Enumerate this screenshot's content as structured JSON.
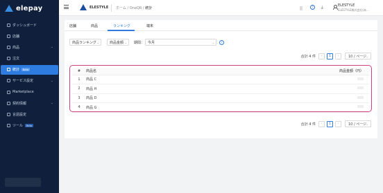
{
  "app": {
    "logo_text": "elepay"
  },
  "sidebar": {
    "items": [
      {
        "label": "ダッシュボード",
        "icon": "clock-icon",
        "chevron": false,
        "badge": "",
        "active": false
      },
      {
        "label": "店舗",
        "icon": "store-icon",
        "chevron": false,
        "badge": "",
        "active": false
      },
      {
        "label": "商品",
        "icon": "tag-icon",
        "chevron": true,
        "badge": "",
        "active": false
      },
      {
        "label": "注文",
        "icon": "cart-icon",
        "chevron": false,
        "badge": "",
        "active": false
      },
      {
        "label": "統計",
        "icon": "chart-icon",
        "chevron": false,
        "badge": "Beta",
        "active": true
      },
      {
        "label": "サービス設定",
        "icon": "gear-icon",
        "chevron": true,
        "badge": "",
        "active": false
      },
      {
        "label": "Marketplace",
        "icon": "grid-icon",
        "chevron": false,
        "badge": "",
        "active": false
      },
      {
        "label": "契約情報",
        "icon": "document-icon",
        "chevron": true,
        "badge": "",
        "active": false
      },
      {
        "label": "言語設定",
        "icon": "globe-icon",
        "chevron": false,
        "badge": "",
        "active": false
      },
      {
        "label": "ツール",
        "icon": "wrench-icon",
        "chevron": false,
        "badge": "Beta",
        "active": false
      }
    ]
  },
  "topbar": {
    "company": "ELESTYLE",
    "breadcrumb": {
      "home": "ホーム",
      "sep1": "/",
      "mid": "OneQR",
      "sep2": "/",
      "current": "統計"
    },
    "user_name": "ELESTYLE",
    "user_sub": "ELESTYLE株式会社(本..."
  },
  "tabs": [
    {
      "label": "店舗",
      "active": false
    },
    {
      "label": "商品",
      "active": false
    },
    {
      "label": "ランキング",
      "active": true
    },
    {
      "label": "端末",
      "active": false
    }
  ],
  "filters": {
    "ranking_type": "商品ランキング",
    "metric": "商品金額",
    "period_label": "期間：",
    "period_value": "今月"
  },
  "pagination": {
    "total_text": "合計 4 件",
    "prev": "‹",
    "current_page": "1",
    "next": "›",
    "page_size": "10 / ページ"
  },
  "table": {
    "headers": {
      "num": "#",
      "name": "商品名",
      "amount": "商品金額（円）"
    },
    "rows": [
      {
        "num": "1",
        "name": "商品 C"
      },
      {
        "num": "2",
        "name": "商品 H"
      },
      {
        "num": "3",
        "name": "商品 D"
      },
      {
        "num": "4",
        "name": "商品 G"
      }
    ]
  },
  "colors": {
    "sidebar_bg": "#0f1f3c",
    "accent": "#2f7ce0",
    "highlight": "#d63b86"
  }
}
